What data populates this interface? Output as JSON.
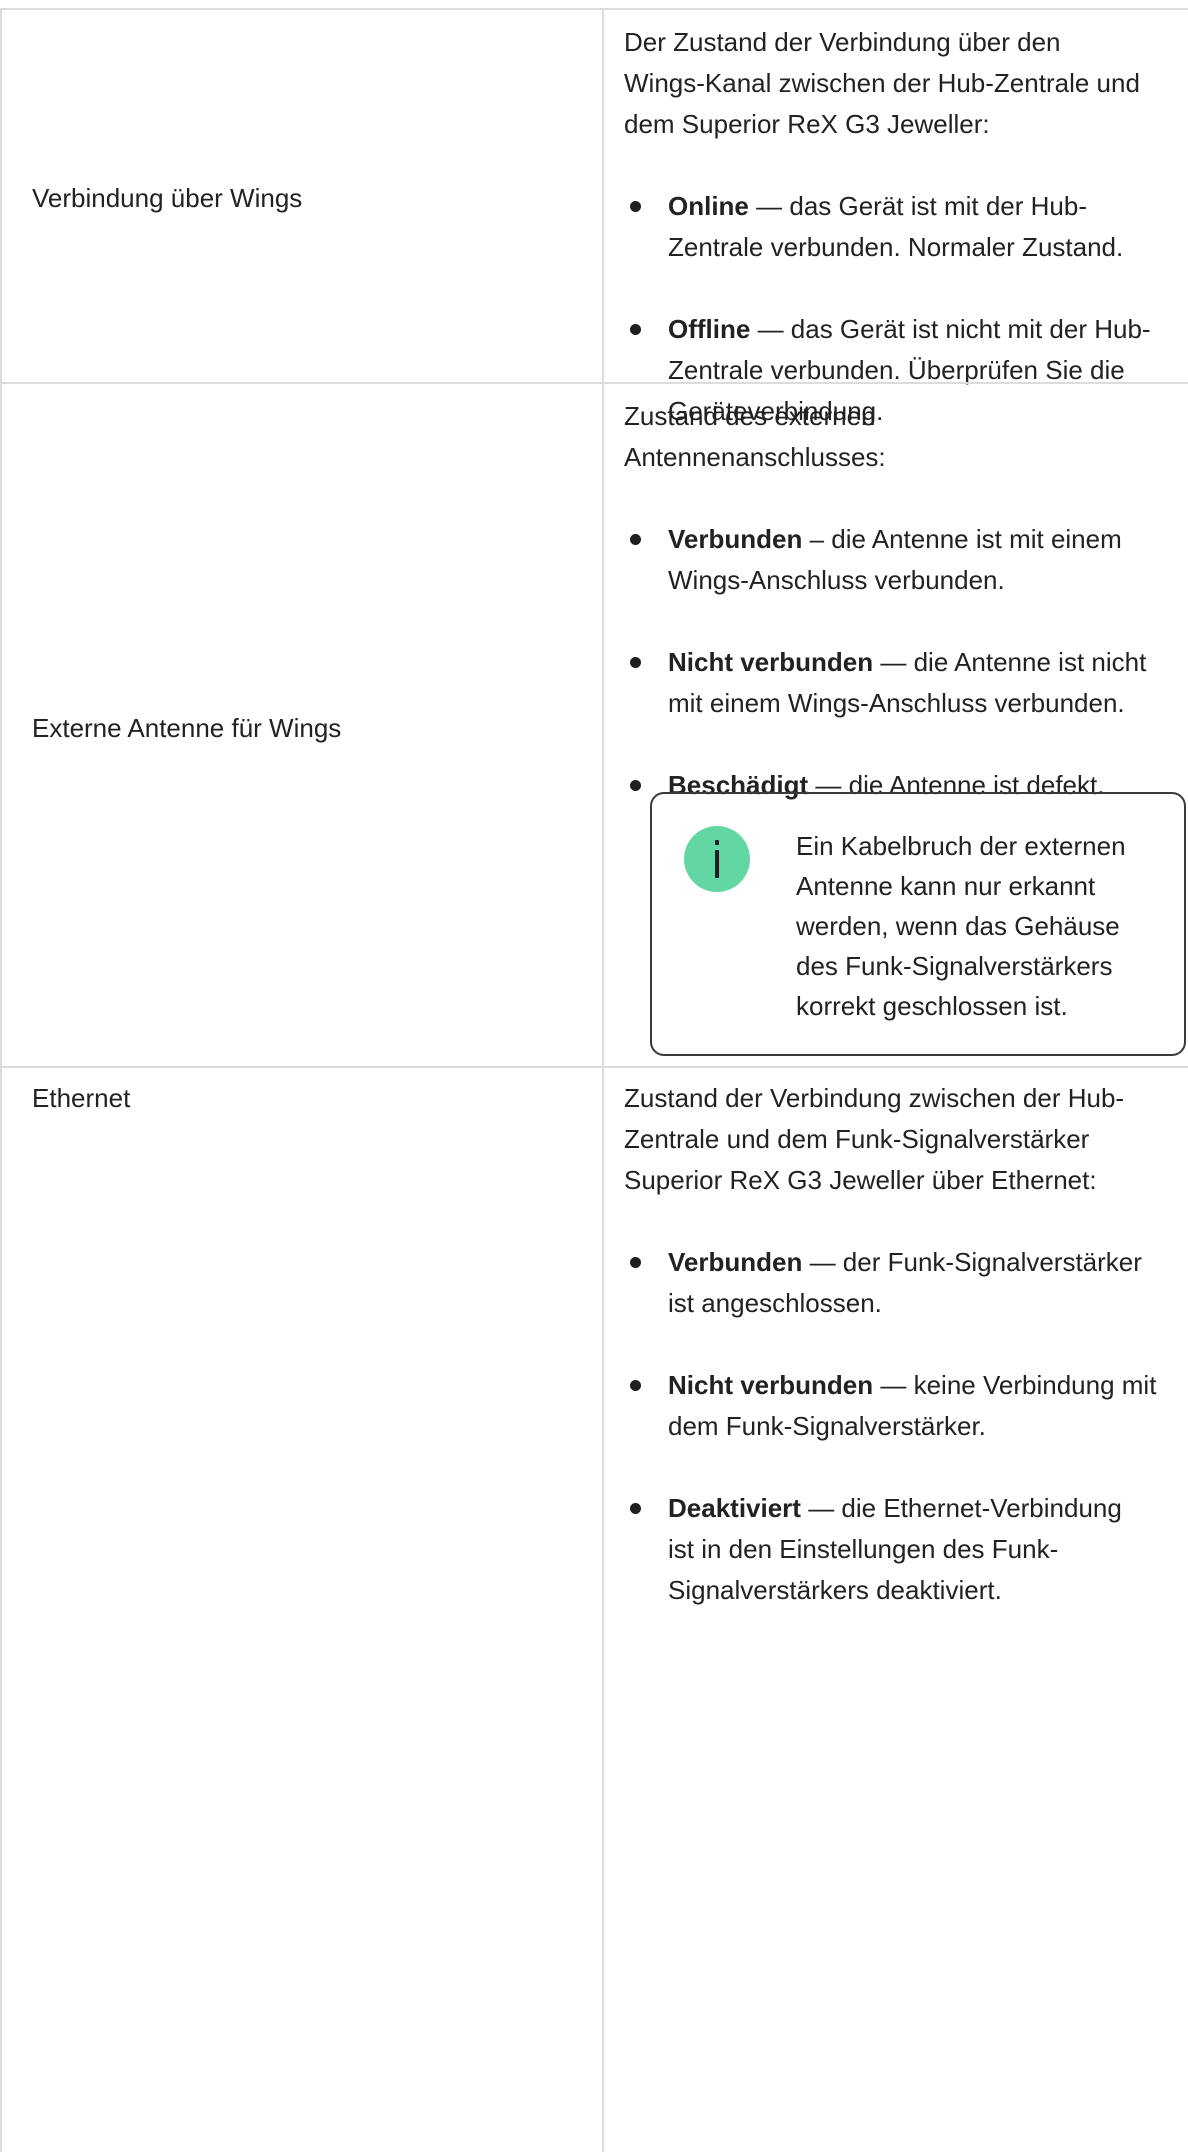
{
  "rows": [
    {
      "label": "Verbindung über Wings",
      "intro": [
        "Der Zustand der Verbindung über den",
        "Wings-Kanal zwischen der Hub-Zentrale und",
        "dem Superior ReX G3 Jeweller:"
      ],
      "items": [
        {
          "term": "Online",
          "lines": [
            " — das Gerät ist mit der Hub-",
            "Zentrale verbunden. Normaler Zustand."
          ]
        },
        {
          "term": "Offline",
          "lines": [
            " — das Gerät ist nicht mit der Hub-",
            "Zentrale verbunden. Überprüfen Sie die",
            "Geräteverbindung."
          ]
        }
      ]
    },
    {
      "label": "Externe Antenne für Wings",
      "intro": [
        "Zustand des externen",
        "Antennenanschlusses:"
      ],
      "items": [
        {
          "term": "Verbunden",
          "lines": [
            " – die Antenne ist mit einem",
            "Wings-Anschluss verbunden."
          ]
        },
        {
          "term": "Nicht verbunden",
          "lines": [
            " — die Antenne ist nicht",
            "mit einem Wings-Anschluss verbunden."
          ]
        },
        {
          "term": "Beschädigt",
          "lines": [
            " — die Antenne ist defekt."
          ]
        }
      ],
      "note": {
        "icon": "info-icon",
        "lines": [
          "Ein Kabelbruch der externen",
          "Antenne kann nur erkannt",
          "werden, wenn das Gehäuse",
          "des Funk-Signalverstärkers",
          "korrekt geschlossen ist."
        ]
      }
    },
    {
      "label": "Ethernet",
      "intro": [
        "Zustand der Verbindung zwischen der Hub-",
        "Zentrale und dem Funk-Signalverstärker",
        "Superior ReX G3 Jeweller über Ethernet:"
      ],
      "items": [
        {
          "term": "Verbunden",
          "lines": [
            " — der Funk-Signalverstärker",
            "ist angeschlossen."
          ]
        },
        {
          "term": "Nicht verbunden",
          "lines": [
            " — keine Verbindung mit",
            "dem Funk-Signalverstärker."
          ]
        },
        {
          "term": "Deaktiviert",
          "lines": [
            " — die Ethernet-Verbindung",
            "ist in den Einstellungen des Funk-",
            "Signalverstärkers deaktiviert."
          ]
        }
      ]
    }
  ],
  "colors": {
    "border": "#dcdcdc",
    "info_icon": "#62d6a3",
    "text": "#222222"
  }
}
